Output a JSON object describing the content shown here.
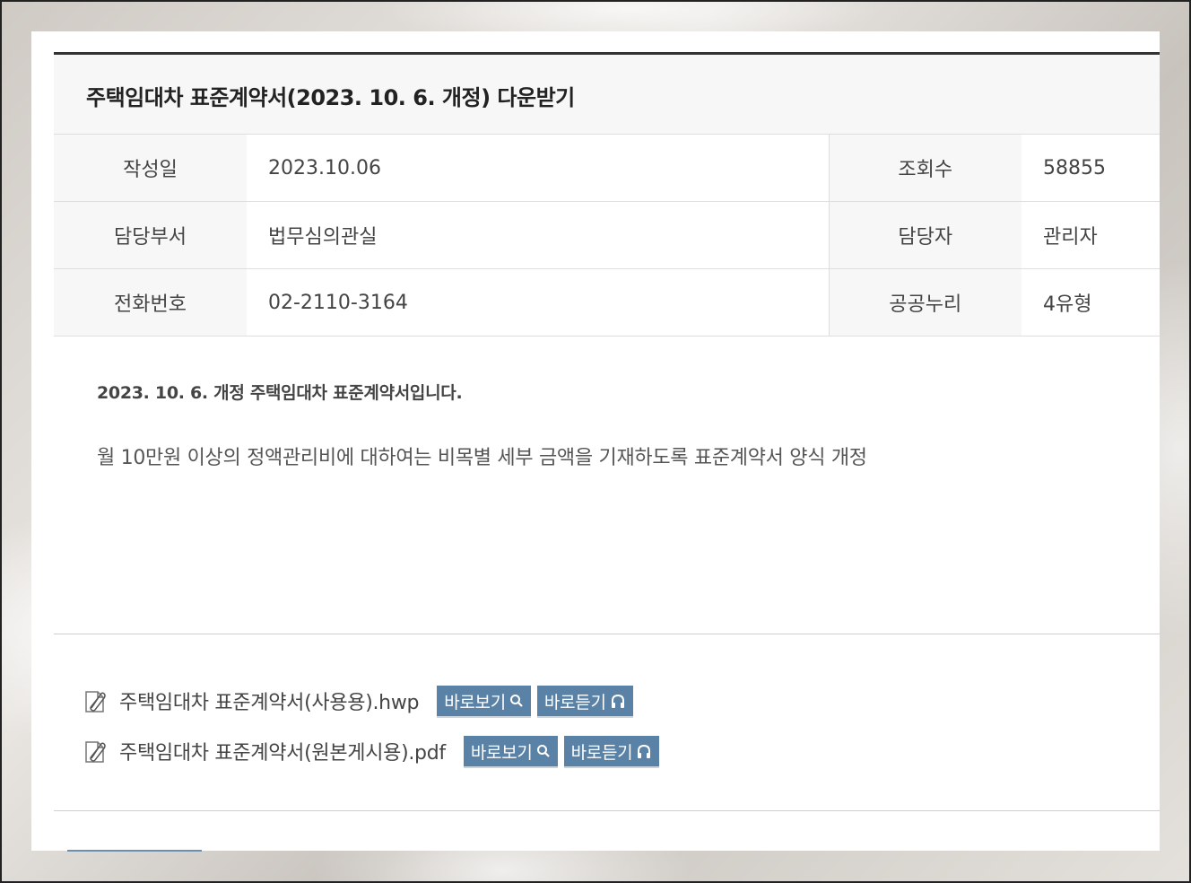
{
  "post": {
    "title": "주택임대차 표준계약서(2023. 10. 6. 개정) 다운받기"
  },
  "info": {
    "rows": [
      {
        "label1": "작성일",
        "value1": "2023.10.06",
        "label2": "조회수",
        "value2": "58855"
      },
      {
        "label1": "담당부서",
        "value1": "법무심의관실",
        "label2": "담당자",
        "value2": "관리자"
      },
      {
        "label1": "전화번호",
        "value1": "02-2110-3164",
        "label2": "공공누리",
        "value2": "4유형"
      }
    ]
  },
  "content": {
    "lead": "2023. 10. 6. 개정 주택임대차 표준계약서입니다.",
    "body": "월 10만원 이상의 정액관리비에 대하여는 비목별 세부 금액을 기재하도록 표준계약서 양식 개정"
  },
  "attachments": [
    {
      "filename": "주택임대차 표준계약서(사용용).hwp",
      "view_label": "바로보기",
      "listen_label": "바로듣기",
      "file_icon": "paperclip-document-icon"
    },
    {
      "filename": "주택임대차 표준계약서(원본게시용).pdf",
      "view_label": "바로보기",
      "listen_label": "바로듣기",
      "file_icon": "paperclip-document-icon"
    }
  ],
  "colors": {
    "button_bg": "#5a82a6",
    "title_border": "#333333",
    "header_bg": "#f7f7f7"
  }
}
